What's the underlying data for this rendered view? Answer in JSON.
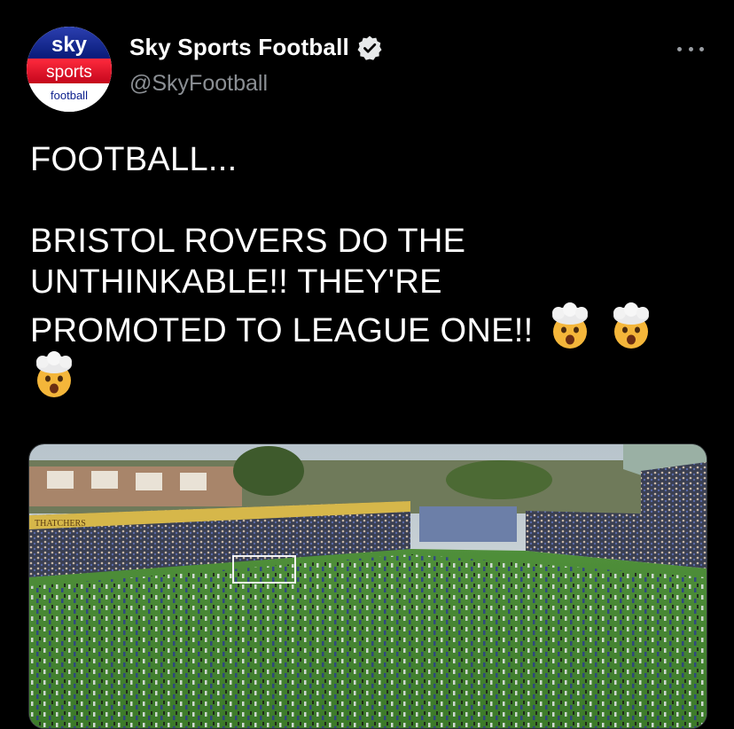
{
  "tweet": {
    "author": {
      "display_name": "Sky Sports Football",
      "handle": "@SkyFootball",
      "verified": true,
      "avatar_text": {
        "line1": "sky",
        "line2": "sports",
        "line3": "football"
      }
    },
    "text": {
      "line1": "FOOTBALL...",
      "line2": "BRISTOL ROVERS DO THE",
      "line3": "UNTHINKABLE!! THEY'RE",
      "line4": "PROMOTED TO LEAGUE ONE!!"
    },
    "emojis": [
      "exploding-head-emoji",
      "exploding-head-emoji",
      "exploding-head-emoji"
    ],
    "media": {
      "type": "photo",
      "sponsor_text": "THATCHERS"
    }
  },
  "icons": {
    "more": "more-horizontal-icon",
    "verified": "verified-badge-icon"
  },
  "colors": {
    "background": "#000000",
    "text_primary": "#ffffff",
    "text_secondary": "#8b8f94",
    "sky_blue": "#0a1e8c",
    "sky_red": "#e00d2c"
  }
}
